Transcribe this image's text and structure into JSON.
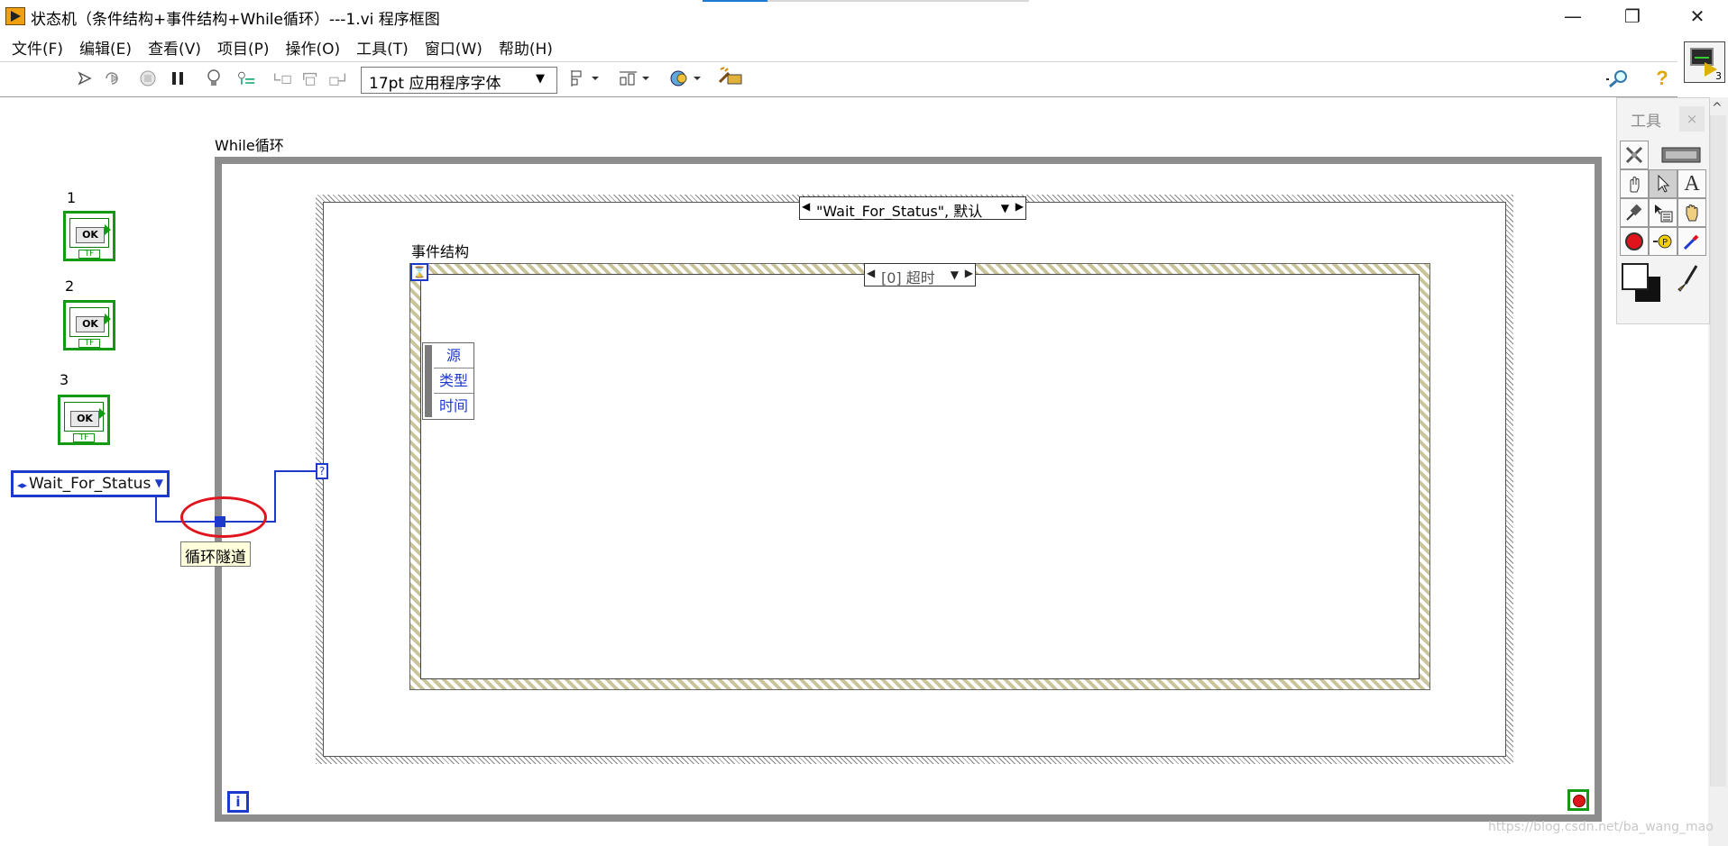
{
  "window": {
    "title": "状态机（条件结构+事件结构+While循环）---1.vi 程序框图",
    "minimize": "—",
    "maximize": "❐",
    "close": "✕"
  },
  "menu": [
    "文件(F)",
    "编辑(E)",
    "查看(V)",
    "项目(P)",
    "操作(O)",
    "工具(T)",
    "窗口(W)",
    "帮助(H)"
  ],
  "toolbar": {
    "font_select": "17pt 应用程序字体",
    "icons": [
      "run-arrow-icon",
      "run-continuous-icon",
      "abort-icon",
      "pause-icon",
      "highlight-execution-icon",
      "retain-wire-values-icon",
      "step-into-icon",
      "step-over-icon",
      "step-out-icon",
      "align-icon",
      "distribute-icon",
      "reorder-icon",
      "cleanup-icon",
      "search-icon",
      "help-icon"
    ],
    "vi_icon_number": "3"
  },
  "diagram": {
    "bool_controls": [
      {
        "label": "1",
        "button_text": "OK",
        "tf_text": "TF"
      },
      {
        "label": "2",
        "button_text": "OK",
        "tf_text": "TF"
      },
      {
        "label": "3",
        "button_text": "OK",
        "tf_text": "TF"
      }
    ],
    "enum_constant": "Wait_For_Status",
    "while_loop_label": "While循环",
    "case_selector": "\"Wait_For_Status\", 默认",
    "event_structure_label": "事件结构",
    "event_selector": "[0] 超时",
    "event_data": [
      "源",
      "类型",
      "时间"
    ],
    "tunnel_tooltip": "循环隧道",
    "selector_terminal": "?",
    "iteration_terminal": "i"
  },
  "tools_palette": {
    "title": "工具",
    "close": "×",
    "tools": [
      "auto-tool-icon",
      "color-display-icon",
      "operate-hand-icon",
      "position-arrow-icon",
      "edit-text-icon",
      "wiring-spool-icon",
      "shortcut-menu-icon",
      "scroll-hand-icon",
      "breakpoint-icon",
      "probe-icon",
      "get-color-icon",
      "set-color-icon",
      "paintbrush-icon"
    ]
  },
  "watermark": "https://blog.csdn.net/ba_wang_mao",
  "colors": {
    "wire_blue": "#1e3acc",
    "bool_green": "#139913",
    "highlight_red": "#e0141c",
    "loop_gray": "#8d8d8d"
  }
}
